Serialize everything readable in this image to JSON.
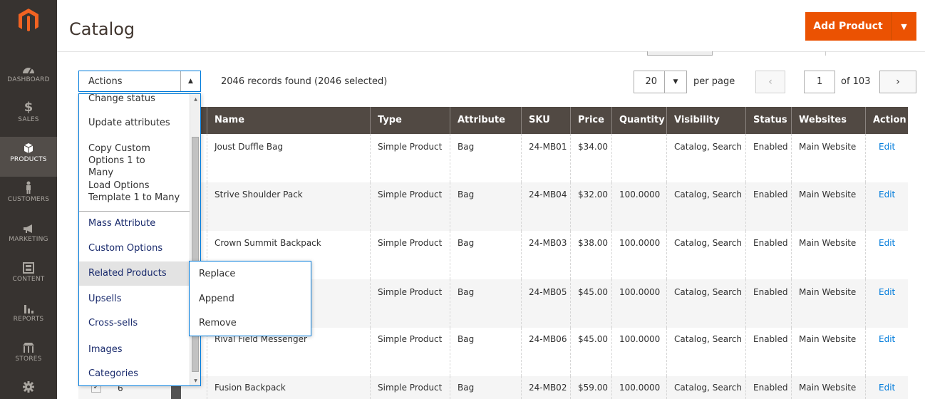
{
  "sidebar": {
    "items": [
      {
        "label": "DASHBOARD",
        "icon": "dashboard-icon"
      },
      {
        "label": "SALES",
        "icon": "dollar-icon"
      },
      {
        "label": "PRODUCTS",
        "icon": "box-icon"
      },
      {
        "label": "CUSTOMERS",
        "icon": "person-icon"
      },
      {
        "label": "MARKETING",
        "icon": "megaphone-icon"
      },
      {
        "label": "CONTENT",
        "icon": "layout-icon"
      },
      {
        "label": "REPORTS",
        "icon": "bar-chart-icon"
      },
      {
        "label": "STORES",
        "icon": "store-icon"
      },
      {
        "label": "",
        "icon": "gear-icon"
      }
    ]
  },
  "header": {
    "title": "Catalog",
    "add_product": "Add Product",
    "add_product_arrow": "▼"
  },
  "toolbar": {
    "actions_label": "Actions",
    "actions_arrow": "▲",
    "records": "2046 records found (2046 selected)",
    "per_page_value": "20",
    "per_page_arrow": "▼",
    "per_page_label": "per page",
    "prev": "‹",
    "page_value": "1",
    "of_pages": "of 103",
    "next": "›"
  },
  "columns": [
    "Name",
    "Type",
    "Attribute Set",
    "SKU",
    "Price",
    "Quantity",
    "Visibility",
    "Status",
    "Websites",
    "Action"
  ],
  "rows": [
    {
      "name": "Joust Duffle Bag",
      "type": "Simple Product",
      "attr": "Bag",
      "sku": "24-MB01",
      "price": "$34.00",
      "qty": "",
      "visibility": "Catalog, Search",
      "status": "Enabled",
      "websites": "Main Website",
      "action": "Edit"
    },
    {
      "name": "Strive Shoulder Pack",
      "type": "Simple Product",
      "attr": "Bag",
      "sku": "24-MB04",
      "price": "$32.00",
      "qty": "100.0000",
      "visibility": "Catalog, Search",
      "status": "Enabled",
      "websites": "Main Website",
      "action": "Edit"
    },
    {
      "name": "Crown Summit Backpack",
      "type": "Simple Product",
      "attr": "Bag",
      "sku": "24-MB03",
      "price": "$38.00",
      "qty": "100.0000",
      "visibility": "Catalog, Search",
      "status": "Enabled",
      "websites": "Main Website",
      "action": "Edit"
    },
    {
      "name": "",
      "type": "Simple Product",
      "attr": "Bag",
      "sku": "24-MB05",
      "price": "$45.00",
      "qty": "100.0000",
      "visibility": "Catalog, Search",
      "status": "Enabled",
      "websites": "Main Website",
      "action": "Edit"
    },
    {
      "name": "Rival Field Messenger",
      "type": "Simple Product",
      "attr": "Bag",
      "sku": "24-MB06",
      "price": "$45.00",
      "qty": "100.0000",
      "visibility": "Catalog, Search",
      "status": "Enabled",
      "websites": "Main Website",
      "action": "Edit"
    },
    {
      "name": "Fusion Backpack",
      "type": "Simple Product",
      "attr": "Bag",
      "sku": "24-MB02",
      "price": "$59.00",
      "qty": "100.0000",
      "visibility": "Catalog, Search",
      "status": "Enabled",
      "websites": "Main Website",
      "action": "Edit"
    }
  ],
  "last_row_number": "6",
  "last_row_checkbox": "✓",
  "actions_menu": {
    "items": [
      "Change status",
      "Update attributes",
      "Copy Custom Options 1 to Many",
      "Load Options Template 1 to Many",
      "Mass Attribute",
      "Custom Options",
      "Related Products",
      "Upsells",
      "Cross-sells",
      "Images",
      "Categories"
    ],
    "submenu": [
      "Replace",
      "Append",
      "Remove"
    ]
  }
}
